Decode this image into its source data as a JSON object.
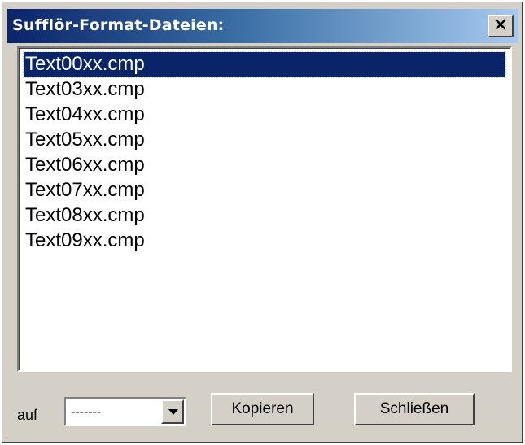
{
  "window": {
    "title": "Sufflör-Format-Dateien:",
    "close_label": "×"
  },
  "list": {
    "selected_index": 0,
    "items": [
      "Text00xx.cmp",
      "Text03xx.cmp",
      "Text04xx.cmp",
      "Text05xx.cmp",
      "Text06xx.cmp",
      "Text07xx.cmp",
      "Text08xx.cmp",
      "Text09xx.cmp"
    ]
  },
  "footer": {
    "label": "auf",
    "combo_value": "-------",
    "copy_label": "Kopieren",
    "close_label": "Schließen"
  },
  "colors": {
    "title_gradient_start": "#0a246a",
    "title_gradient_end": "#a6caf0",
    "selection": "#0a246a",
    "face": "#d4d0c8"
  }
}
